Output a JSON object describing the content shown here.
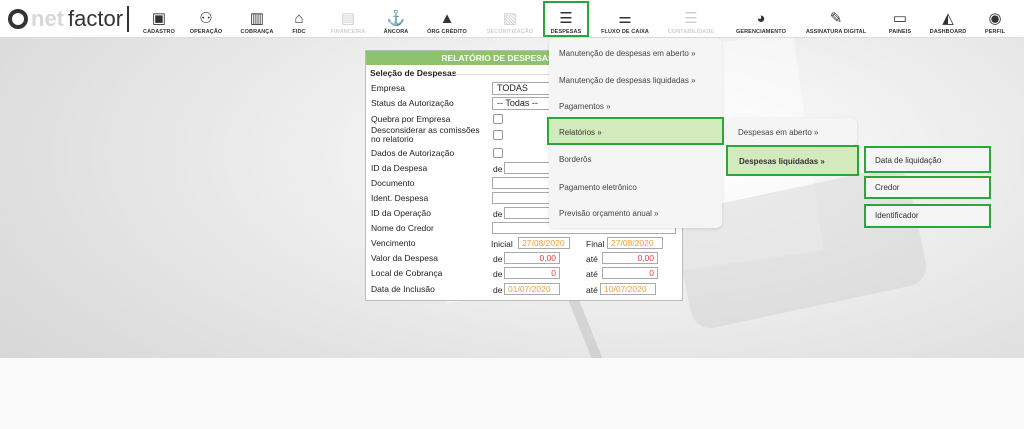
{
  "brand": {
    "logo_o": "O",
    "logo_net": "net",
    "logo_factor": "factor"
  },
  "nav": [
    {
      "label": "CADASTRO",
      "icon": "id-card-icon",
      "glyph": "▣"
    },
    {
      "label": "OPERAÇÃO",
      "icon": "handshake-icon",
      "glyph": "⚇"
    },
    {
      "label": "COBRANÇA",
      "icon": "barcode-icon",
      "glyph": "▥"
    },
    {
      "label": "FIDC",
      "icon": "bank-icon",
      "glyph": "⌂"
    },
    {
      "label": "FINANCEIRA",
      "icon": "money-icon",
      "glyph": "▤"
    },
    {
      "label": "ÂNCORA",
      "icon": "anchor-icon",
      "glyph": "⚓"
    },
    {
      "label": "ÓRG CRÉDITO",
      "icon": "warning-icon",
      "glyph": "▲"
    },
    {
      "label": "SECURITIZAÇÃO",
      "icon": "document-icon",
      "glyph": "▧"
    },
    {
      "label": "DESPESAS",
      "icon": "list-icon",
      "glyph": "☰"
    },
    {
      "label": "FLUXO DE CAIXA",
      "icon": "sliders-icon",
      "glyph": "⚌"
    },
    {
      "label": "CONTABILIDADE",
      "icon": "ledger-icon",
      "glyph": "☰"
    },
    {
      "label": "GERENCIAMENTO",
      "icon": "pie-chart-icon",
      "glyph": "◕"
    },
    {
      "label": "ASSINATURA DIGITAL",
      "icon": "signature-icon",
      "glyph": "✎"
    },
    {
      "label": "PAINEIS",
      "icon": "monitor-icon",
      "glyph": "▭"
    },
    {
      "label": "DASHBOARD",
      "icon": "area-chart-icon",
      "glyph": "◭"
    },
    {
      "label": "PERFIL",
      "icon": "user-icon",
      "glyph": "◉"
    }
  ],
  "form": {
    "title": "RELATÓRIO DE DESPESAS EM ABERTO",
    "section": "Seleção de Despesas",
    "labels": {
      "empresa": "Empresa",
      "status": "Status da Autorização",
      "quebra": "Quebra por Empresa",
      "desconsiderar": "Desconsiderar as comissões no relatorio",
      "dados": "Dados de Autorização",
      "id_despesa": "ID da Despesa",
      "documento": "Documento",
      "ident": "Ident. Despesa",
      "id_operacao": "ID da Operação",
      "credor": "Nome do Credor",
      "vencimento": "Vencimento",
      "valor": "Valor da Despesa",
      "local": "Local de Cobrança",
      "inclusao": "Data de Inclusão"
    },
    "empresa_value": "TODAS",
    "status_value": "-- Todas --",
    "de": "de",
    "ate": "até",
    "inicial": "Inicial",
    "final": "Final",
    "venc_inicial": "27/08/2020",
    "venc_final": "27/08/2020",
    "valor_de": "0,00",
    "valor_ate": "0,00",
    "local_de": "0",
    "local_ate": "0",
    "incl_de": "01/07/2020",
    "incl_ate": "10/07/2020"
  },
  "menu_despesas": [
    "Manutenção de despesas em aberto  »",
    "Manutenção de despesas liquidadas  »",
    "Pagamentos  »",
    "Relatórios  »",
    "Borderôs",
    "Pagamento eletrônico",
    "Previsão orçamento anual  »"
  ],
  "menu_relatorios": [
    "Despesas em aberto  »",
    "Despesas liquidadas  »"
  ],
  "menu_liquidadas": [
    "Data de liquidação",
    "Credor",
    "Identificador"
  ],
  "colors": {
    "accent_green": "#2aa63a",
    "header_green": "#8cc36b",
    "highlight": "#d3eabd"
  }
}
